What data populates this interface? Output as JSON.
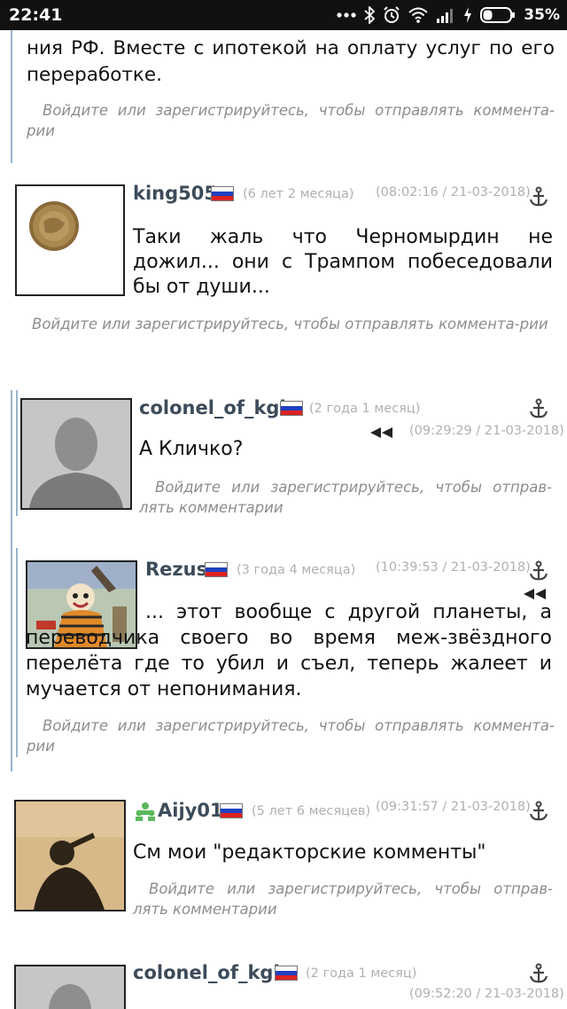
{
  "status_bar": {
    "time": "22:41",
    "battery": "35%",
    "icons": [
      "dots-icon",
      "bluetooth-icon",
      "alarm-icon",
      "wifi-icon",
      "signal-icon",
      "charging-icon",
      "battery-icon"
    ]
  },
  "top_fragment": {
    "text": "ния РФ. Вместе с ипотекой на оплату услуг по его переработке.",
    "login": "Войдите или зарегистрируйтесь, чтобы отправлять коммента-рии"
  },
  "comments": [
    {
      "username": "king505",
      "age": "(6 лет 2 месяца)",
      "timestamp": "(08:02:16 / 21-03-2018)",
      "text": "Таки жаль что Черномырдин не дожил... они с Трампом побеседовали бы от души...",
      "login": "Войдите или зарегистрируйтесь, чтобы отправлять коммента-рии"
    },
    {
      "username": "colonel_of_kgb",
      "age": "(2 года 1 месяц)",
      "timestamp": "(09:29:29 / 21-03-2018)",
      "text": "А Кличко?",
      "login": "Войдите или зарегистрируйтесь, чтобы отправ-лять комментарии"
    },
    {
      "username": "Rezus",
      "age": "(3 года 4 месяца)",
      "timestamp": "(10:39:53 / 21-03-2018)",
      "text": "... этот вообще с другой планеты, а переводчика своего во время меж-звёздного перелёта где то убил и съел, теперь жалеет и мучается от непонимания.",
      "login": "Войдите или зарегистрируйтесь, чтобы отправлять коммента-рии"
    },
    {
      "username": "Aijy01",
      "age": "(5 лет 6 месяцев)",
      "timestamp": "(09:31:57 / 21-03-2018)",
      "text": "См мои \"редакторские комменты\"",
      "login": "Войдите или зарегистрируйтесь, чтобы отправ-лять комментарии"
    },
    {
      "username": "colonel_of_kgb",
      "age": "(2 года 1 месяц)",
      "timestamp": "(09:52:20 / 21-03-2018)"
    }
  ],
  "colors": {
    "username": "#3d4b5a",
    "meta": "#b0b0b0",
    "login_text": "#8d8d8d",
    "thread_line": "#9ab4cc"
  }
}
